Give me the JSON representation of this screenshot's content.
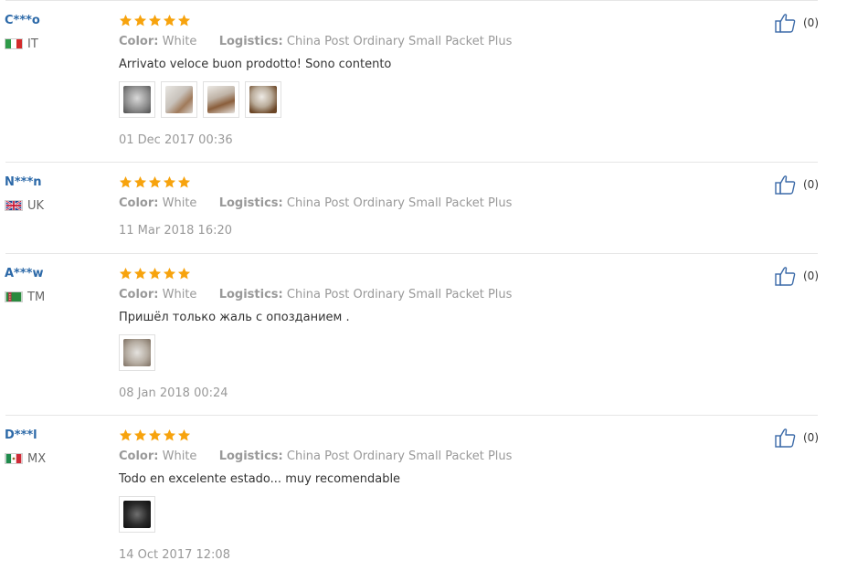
{
  "colors": {
    "username": "#2c69a8",
    "star": "#f7a30d",
    "muted": "#999999",
    "divider": "#e6e6e6",
    "thumbs_icon": "#3b6aa8"
  },
  "icons": {
    "star": "star-icon",
    "helpful": "thumbs-up-icon"
  },
  "reviews": [
    {
      "user": "C***o",
      "country": "IT",
      "flag": "flag-italy",
      "rating": 5,
      "color_label": "Color:",
      "color_value": "White",
      "logistics_label": "Logistics:",
      "logistics_value": "China Post Ordinary Small Packet Plus",
      "comment": "Arrivato veloce buon prodotto! Sono contento",
      "photo_count": 4,
      "date": "01 Dec 2017 00:36",
      "helpful": "(0)"
    },
    {
      "user": "N***n",
      "country": "UK",
      "flag": "flag-uk",
      "rating": 5,
      "color_label": "Color:",
      "color_value": "White",
      "logistics_label": "Logistics:",
      "logistics_value": "China Post Ordinary Small Packet Plus",
      "comment": "",
      "photo_count": 0,
      "date": "11 Mar 2018 16:20",
      "helpful": "(0)"
    },
    {
      "user": "A***w",
      "country": "TM",
      "flag": "flag-turkmenistan",
      "rating": 5,
      "color_label": "Color:",
      "color_value": "White",
      "logistics_label": "Logistics:",
      "logistics_value": "China Post Ordinary Small Packet Plus",
      "comment": "Пришёл только жаль с опозданием .",
      "photo_count": 1,
      "date": "08 Jan 2018 00:24",
      "helpful": "(0)"
    },
    {
      "user": "D***l",
      "country": "MX",
      "flag": "flag-mexico",
      "rating": 5,
      "color_label": "Color:",
      "color_value": "White",
      "logistics_label": "Logistics:",
      "logistics_value": "China Post Ordinary Small Packet Plus",
      "comment": "Todo en excelente estado... muy recomendable",
      "photo_count": 1,
      "date": "14 Oct 2017 12:08",
      "helpful": "(0)"
    }
  ]
}
